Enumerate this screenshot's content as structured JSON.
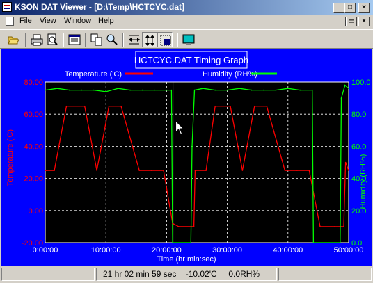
{
  "window": {
    "title": "KSON DAT Viewer - [D:\\Temp\\HCTCYC.dat]"
  },
  "window_buttons": {
    "minimize": "_",
    "maximize": "□",
    "close": "×"
  },
  "mdi_buttons": {
    "minimize": "_",
    "restore": "▭",
    "close": "×"
  },
  "menu": [
    "File",
    "View",
    "Window",
    "Help"
  ],
  "toolbar_icons": [
    "open-icon",
    "print-icon",
    "print-preview-icon",
    "view-data-icon",
    "copy-icon",
    "zoom-icon",
    "zoom-x-icon",
    "zoom-y-icon",
    "zoom-box-icon",
    "about-icon"
  ],
  "status": {
    "readout": "21 hr 02 min 59 sec    -10.02'C     0.0RH%"
  },
  "colors": {
    "plot_background": "#0000ff",
    "plot_area": "#000000",
    "temperature": "#ff0000",
    "humidity": "#00ff00",
    "cursor": "#ffffff"
  },
  "chart_data": {
    "type": "line",
    "title": "HCTCYC.DAT Timing Graph",
    "xlabel": "Time (hr:min:sec)",
    "ylabel": "Temperature ('C)",
    "y2label": "Humidity (RH%)",
    "xlim": [
      0,
      50
    ],
    "ylim": [
      -20,
      80
    ],
    "y2lim": [
      0,
      100
    ],
    "grid": true,
    "legend": "top-center",
    "x_ticks": [
      "0:00:00",
      "10:00:00",
      "20:00:00",
      "30:00:00",
      "40:00:00",
      "50:00:00"
    ],
    "y_ticks": [
      "-20.00",
      "0.00",
      "20.00",
      "40.00",
      "60.00",
      "80.00"
    ],
    "y2_ticks": [
      "0.0",
      "20.0",
      "40.0",
      "60.0",
      "80.0",
      "100.0"
    ],
    "cursor_x": 21.05,
    "series": [
      {
        "name": "Temperature ('C)",
        "axis": "left",
        "x": [
          0,
          1.5,
          3.5,
          6.5,
          8.5,
          10.5,
          12.5,
          15.5,
          17.5,
          19.5,
          21.0,
          22.0,
          24.5,
          24.7,
          26.5,
          28.0,
          30.5,
          32.5,
          34.5,
          36.5,
          39.5,
          41.5,
          43.5,
          45.3,
          47.7,
          49.2,
          49.5,
          50
        ],
        "values": [
          25,
          25,
          65,
          65,
          25,
          65,
          65,
          25,
          25,
          25,
          -8,
          -10,
          -10,
          25,
          25,
          65,
          65,
          25,
          65,
          65,
          25,
          25,
          25,
          -10,
          -10,
          -10,
          30,
          25
        ]
      },
      {
        "name": "Humidity (RH%)",
        "axis": "right",
        "x": [
          0,
          2,
          4,
          6,
          8,
          10,
          12,
          14,
          16,
          18,
          20,
          20.8,
          21,
          24,
          24.2,
          24.6,
          26,
          28,
          30,
          32,
          34,
          36,
          38,
          40,
          42,
          44,
          44.2,
          48.6,
          48.8,
          49.4,
          50
        ],
        "values": [
          95,
          96,
          95,
          95,
          95,
          94,
          96,
          95,
          95,
          95,
          95,
          95,
          0,
          0,
          60,
          95,
          96,
          95,
          95,
          96,
          95,
          95,
          95,
          96,
          95,
          95,
          0,
          0,
          90,
          98,
          96
        ]
      }
    ]
  }
}
